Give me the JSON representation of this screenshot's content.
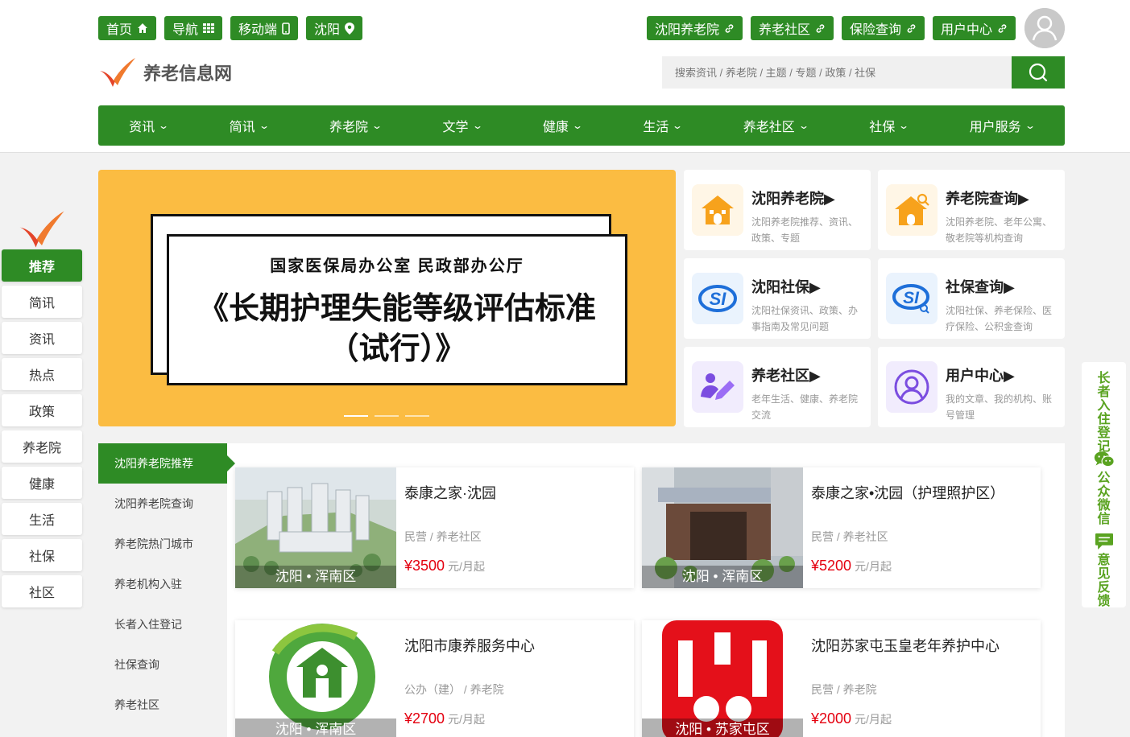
{
  "topbar": {
    "left": [
      {
        "label": "首页",
        "icon": "home-icon"
      },
      {
        "label": "导航",
        "icon": "grid-icon"
      },
      {
        "label": "移动端",
        "icon": "mobile-icon"
      },
      {
        "label": "沈阳",
        "icon": "location-icon"
      }
    ],
    "right": [
      {
        "label": "沈阳养老院",
        "icon": "link-icon"
      },
      {
        "label": "养老社区",
        "icon": "link-icon"
      },
      {
        "label": "保险查询",
        "icon": "link-icon"
      },
      {
        "label": "用户中心",
        "icon": "link-icon"
      }
    ]
  },
  "logo": {
    "text": "养老信息网"
  },
  "search": {
    "placeholder": "搜索资讯 / 养老院 / 主题 / 专题 / 政策 / 社保"
  },
  "nav": [
    "资讯",
    "简讯",
    "养老院",
    "文学",
    "健康",
    "生活",
    "养老社区",
    "社保",
    "用户服务"
  ],
  "left_sidebar": [
    "推荐",
    "简讯",
    "资讯",
    "热点",
    "政策",
    "养老院",
    "健康",
    "生活",
    "社保",
    "社区"
  ],
  "banner": {
    "subtitle": "国家医保局办公室 民政部办公厅",
    "title_line1": "《长期护理失能等级评估标准",
    "title_line2": "（试行）》"
  },
  "services": [
    {
      "title": "沈阳养老院▶",
      "desc": "沈阳养老院推荐、资讯、政策、专题",
      "icon": "house-icon"
    },
    {
      "title": "养老院查询▶",
      "desc": "沈阳养老院、老年公寓、敬老院等机构查询",
      "icon": "house-search-icon"
    },
    {
      "title": "沈阳社保▶",
      "desc": "沈阳社保资讯、政策、办事指南及常见问题",
      "icon": "si-icon"
    },
    {
      "title": "社保查询▶",
      "desc": "沈阳社保、养老保险、医疗保险、公积金查询",
      "icon": "si-search-icon"
    },
    {
      "title": "养老社区▶",
      "desc": "老年生活、健康、养老院交流",
      "icon": "community-icon"
    },
    {
      "title": "用户中心▶",
      "desc": "我的文章、我的机构、账号管理",
      "icon": "user-icon"
    }
  ],
  "panel_nav": [
    "沈阳养老院推荐",
    "沈阳养老院查询",
    "养老院热门城市",
    "养老机构入驻",
    "长者入住登记",
    "社保查询",
    "养老社区"
  ],
  "listings": [
    {
      "name": "泰康之家·沈园",
      "type": "民营 / 养老社区",
      "price": "¥3500",
      "unit": "元/月起",
      "loc": "沈阳 • 浑南区"
    },
    {
      "name": "泰康之家•沈园（护理照护区）",
      "type": "民营 / 养老社区",
      "price": "¥5200",
      "unit": "元/月起",
      "loc": "沈阳 • 浑南区"
    },
    {
      "name": "沈阳市康养服务中心",
      "type": "公办（建） / 养老院",
      "price": "¥2700",
      "unit": "元/月起",
      "loc": "沈阳 • 浑南区"
    },
    {
      "name": "沈阳苏家屯玉皇老年养护中心",
      "type": "民营 / 养老院",
      "price": "¥2000",
      "unit": "元/月起",
      "loc": "沈阳 • 苏家屯区"
    }
  ],
  "right_float": [
    {
      "label": "长者入住登记",
      "icon": "register-icon"
    },
    {
      "label": "公众微信",
      "icon": "wechat-icon"
    },
    {
      "label": "意见反馈",
      "icon": "feedback-icon"
    }
  ],
  "colors": {
    "primary": "#2e8b25",
    "price": "#e4000f",
    "banner": "#fbbc42"
  }
}
